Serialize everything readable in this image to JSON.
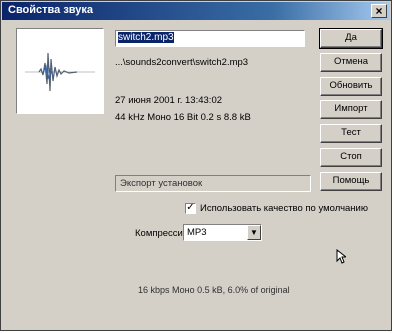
{
  "window": {
    "title": "Свойства звука",
    "close_glyph": "×"
  },
  "file": {
    "name": "switch2.mp3",
    "path": "...\\sounds2convert\\switch2.mp3",
    "date": "27 июня 2001 г. 13:43:02",
    "format": "44 kHz Моно 16 Bit 0.2 s 8.8 kB"
  },
  "buttons": {
    "ok": "Да",
    "cancel": "Отмена",
    "update": "Обновить",
    "import": "Импорт",
    "test": "Тест",
    "stop": "Стоп",
    "help": "Помощь"
  },
  "export": {
    "status": "Экспорт установок",
    "use_default_quality_label": "Использовать качество по умолчанию",
    "use_default_quality_checked": true,
    "checkmark": "✓",
    "compression_label": "Компрессия:",
    "compression_value": "MP3",
    "dropdown_glyph": "▼",
    "summary": "16 kbps Моно 0.5 kB, 6.0% of original"
  }
}
